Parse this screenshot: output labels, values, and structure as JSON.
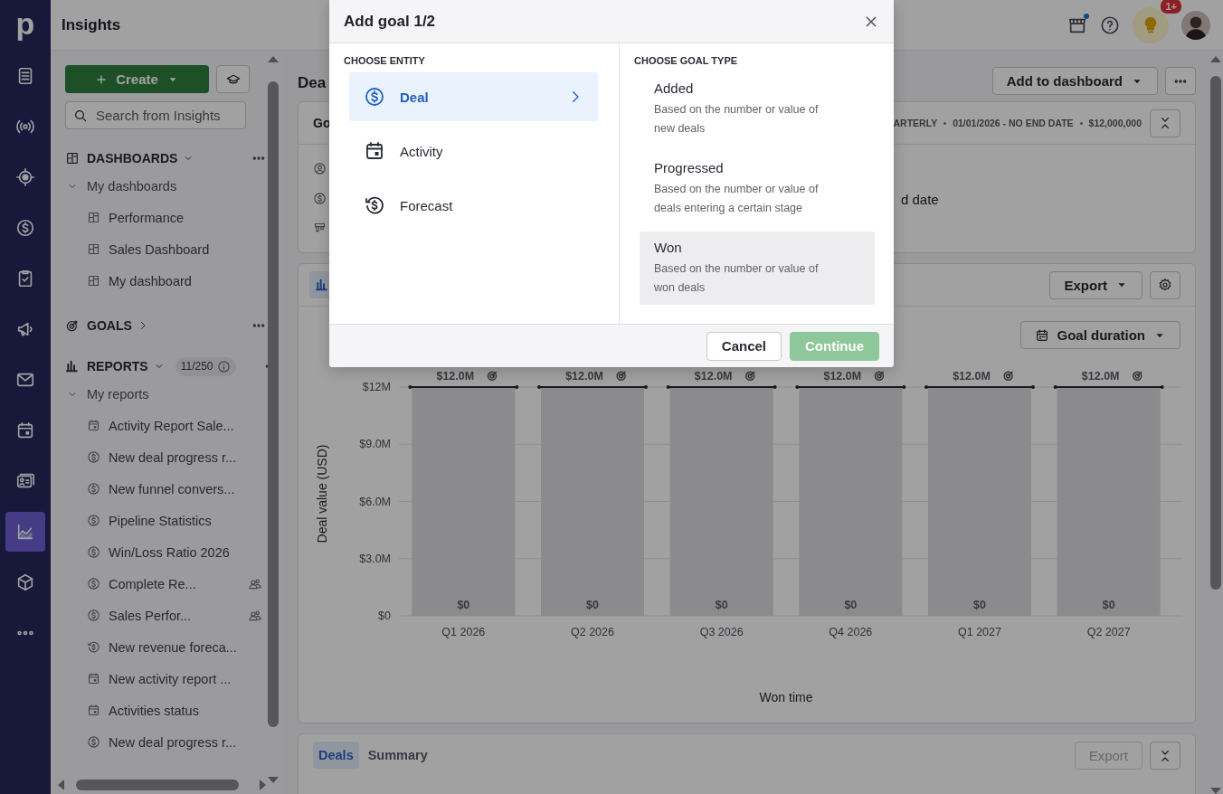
{
  "rail": {
    "logo": "p",
    "items": [
      {
        "kind": "leads",
        "selected": false
      },
      {
        "kind": "signal",
        "selected": false
      },
      {
        "kind": "target",
        "selected": false
      },
      {
        "kind": "deals",
        "selected": false
      },
      {
        "kind": "tasks",
        "selected": false
      },
      {
        "kind": "campaigns",
        "selected": false
      },
      {
        "kind": "mail",
        "selected": false
      },
      {
        "kind": "calendar",
        "selected": false
      },
      {
        "kind": "contacts",
        "selected": false
      },
      {
        "kind": "insights",
        "selected": true
      },
      {
        "kind": "products",
        "selected": false
      },
      {
        "kind": "more",
        "selected": false
      }
    ]
  },
  "topbar": {
    "title": "Insights",
    "tips_badge": "1+"
  },
  "sidebar": {
    "create": "Create",
    "search_placeholder": "Search from Insights",
    "dashboards": {
      "title": "DASHBOARDS",
      "expanded": true,
      "group": {
        "label": "My dashboards",
        "expanded": true
      },
      "items": [
        "Performance",
        "Sales Dashboard",
        "My dashboard"
      ]
    },
    "goals": {
      "title": "GOALS",
      "expanded": false
    },
    "reports": {
      "title": "REPORTS",
      "expanded": true,
      "count": "11/250",
      "group": {
        "label": "My reports",
        "expanded": true
      },
      "items": [
        {
          "kind": "activity",
          "label": "Activity Report Sale...",
          "shared": false
        },
        {
          "kind": "deal",
          "label": "New deal progress r...",
          "shared": false
        },
        {
          "kind": "deal",
          "label": "New funnel convers...",
          "shared": false
        },
        {
          "kind": "deal",
          "label": "Pipeline Statistics",
          "shared": false
        },
        {
          "kind": "deal",
          "label": "Win/Loss Ratio 2026",
          "shared": false
        },
        {
          "kind": "deal",
          "label": "Complete Re...",
          "shared": true
        },
        {
          "kind": "deal",
          "label": "Sales Perfor...",
          "shared": true
        },
        {
          "kind": "forecast",
          "label": "New revenue foreca...",
          "shared": false
        },
        {
          "kind": "activity",
          "label": "New activity report ...",
          "shared": false
        },
        {
          "kind": "activity",
          "label": "Activities status",
          "shared": false
        },
        {
          "kind": "deal",
          "label": "New deal progress r...",
          "shared": false
        }
      ]
    }
  },
  "main": {
    "title": "Dea",
    "add_to_dashboard": "Add to dashboard",
    "goal_card": {
      "title": "Go",
      "meta": [
        "ARTERLY",
        "01/01/2026 - NO END DATE",
        "$12,000,000"
      ],
      "detail": "d date"
    },
    "report_card": {
      "export": "Export",
      "period": "Goal duration",
      "chart_data": {
        "type": "bar",
        "xlabel": "Won time",
        "ylabel": "Deal value (USD)",
        "categories": [
          "Q1 2026",
          "Q2 2026",
          "Q3 2026",
          "Q4 2026",
          "Q1 2027",
          "Q2 2027"
        ],
        "series": [
          {
            "color": "#dcdce0",
            "values": [
              12000000,
              12000000,
              12000000,
              12000000,
              12000000,
              12000000
            ],
            "value_labels": [
              "$12.0M",
              "$12.0M",
              "$12.0M",
              "$12.0M",
              "$12.0M",
              "$12.0M"
            ]
          },
          {
            "values": [
              0,
              0,
              0,
              0,
              0,
              0
            ],
            "value_labels": [
              "$0",
              "$0",
              "$0",
              "$0",
              "$0",
              "$0"
            ]
          }
        ],
        "ylim": [
          0,
          12000000
        ],
        "yticks": [
          {
            "value": 0,
            "label": "$0"
          },
          {
            "value": 3000000,
            "label": "$3.0M"
          },
          {
            "value": 6000000,
            "label": "$6.0M"
          },
          {
            "value": 9000000,
            "label": "$9.0M"
          },
          {
            "value": 12000000,
            "label": "$12M"
          }
        ],
        "grid": true
      }
    },
    "table_card": {
      "tabs": [
        {
          "label": "Deals",
          "selected": true
        },
        {
          "label": "Summary",
          "selected": false
        }
      ],
      "export": {
        "label": "Export",
        "disabled": true
      }
    }
  },
  "modal": {
    "title": "Add goal 1/2",
    "entity_heading": "CHOOSE ENTITY",
    "entities": [
      {
        "kind": "deal",
        "label": "Deal",
        "selected": true
      },
      {
        "kind": "activity",
        "label": "Activity",
        "selected": false
      },
      {
        "kind": "forecast",
        "label": "Forecast",
        "selected": false
      }
    ],
    "type_heading": "CHOOSE GOAL TYPE",
    "types": [
      {
        "label": "Added",
        "description": "Based on the number or value of new deals",
        "selected": false
      },
      {
        "label": "Progressed",
        "description": "Based on the number or value of deals entering a certain stage",
        "selected": false
      },
      {
        "label": "Won",
        "description": "Based on the number or value of won deals",
        "selected": true
      }
    ],
    "cancel": "Cancel",
    "continue": {
      "label": "Continue",
      "disabled": true
    }
  }
}
